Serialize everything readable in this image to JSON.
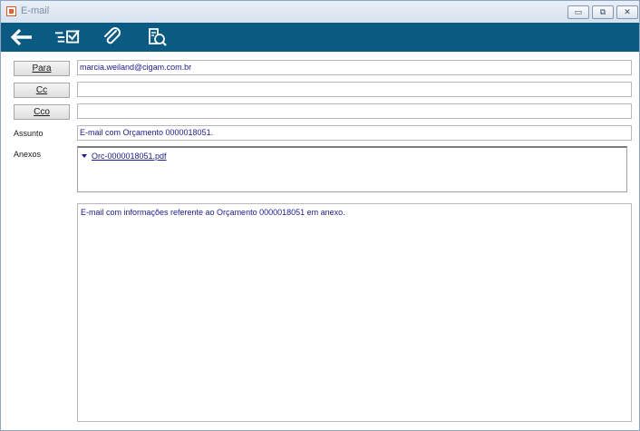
{
  "window": {
    "title": "E-mail",
    "minimize_glyph": "▭",
    "restore_glyph": "⧉",
    "close_glyph": "✕"
  },
  "toolbar": {
    "icons": [
      "back-arrow-icon",
      "checklist-icon",
      "paperclip-icon",
      "search-document-icon"
    ]
  },
  "form": {
    "para_label": "Para",
    "para_value": "marcia.weiland@cigam.com.br",
    "cc_label": "Cc",
    "cc_value": "",
    "cco_label": "Cco",
    "cco_value": "",
    "assunto_label": "Assunto",
    "assunto_value": "E-mail com Orçamento 0000018051.",
    "anexos_label": "Anexos",
    "attachments": [
      {
        "name": "Orc-0000018051.pdf"
      }
    ],
    "body": "E-mail com informações referente ao Orçamento 0000018051 em anexo."
  },
  "colors": {
    "toolbar": "#0b5a82",
    "field_text": "#1b1b8c"
  }
}
